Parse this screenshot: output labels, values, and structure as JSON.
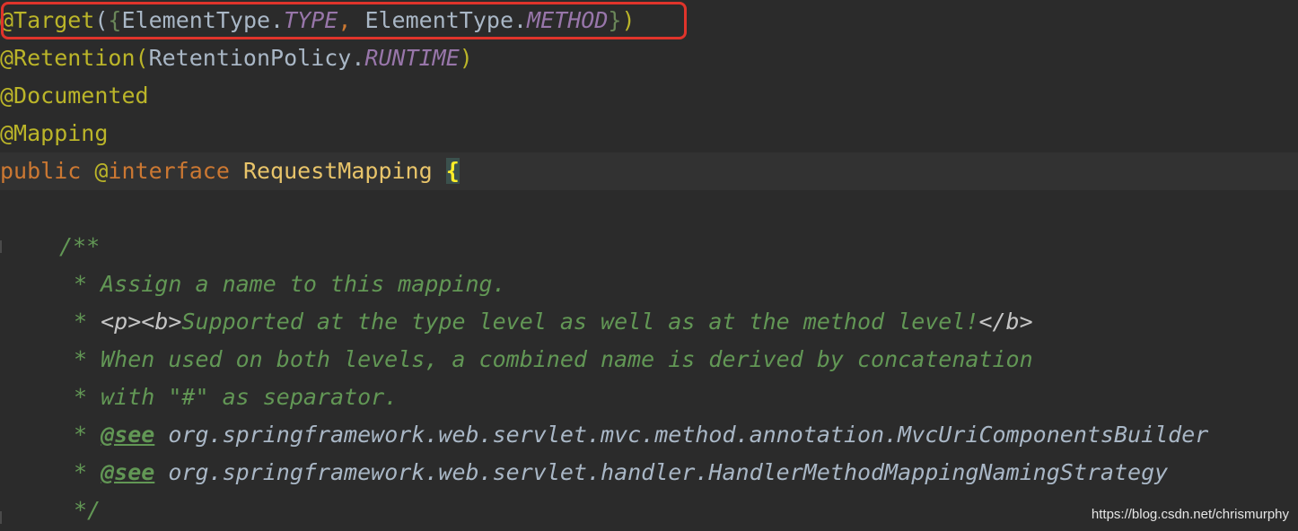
{
  "code": {
    "line1": {
      "annotation": "@Target",
      "open": "(",
      "brace_open": "{",
      "class1": "ElementType.",
      "const1": "TYPE",
      "comma": ",",
      "class2": " ElementType.",
      "const2": "METHOD",
      "brace_close": "}",
      "close": ")"
    },
    "line2": {
      "annotation": "@Retention",
      "open": "(",
      "class": "RetentionPolicy.",
      "const": "RUNTIME",
      "close": ")"
    },
    "line3": {
      "annotation": "@Documented"
    },
    "line4": {
      "annotation": "@Mapping"
    },
    "line5": {
      "keyword1": "public",
      "at": " @",
      "keyword2": "interface",
      "name": " RequestMapping ",
      "brace": "{"
    },
    "doc": {
      "open": "/**",
      "line1": "* Assign a name to this mapping.",
      "line2_prefix": "* ",
      "line2_html_open": "<p><b>",
      "line2_text": "Supported at the type level as well as at the method level!",
      "line2_html_close": "</b>",
      "line3": "* When used on both levels, a combined name is derived by concatenation",
      "line4": "* with \"#\" as separator.",
      "see_prefix": "* ",
      "see_tag": "@see",
      "see1_ref": " org.springframework.web.servlet.mvc.method.annotation.MvcUriComponentsBuilder",
      "see2_ref": " org.springframework.web.servlet.handler.HandlerMethodMappingNamingStrategy",
      "close": "*/"
    }
  },
  "watermark": "https://blog.csdn.net/chrismurphy",
  "colors": {
    "background": "#2b2b2b",
    "annotation": "#bbb529",
    "keyword": "#cc7832",
    "constant": "#9876aa",
    "doc_comment": "#629755",
    "highlight_box": "#e0342b"
  }
}
